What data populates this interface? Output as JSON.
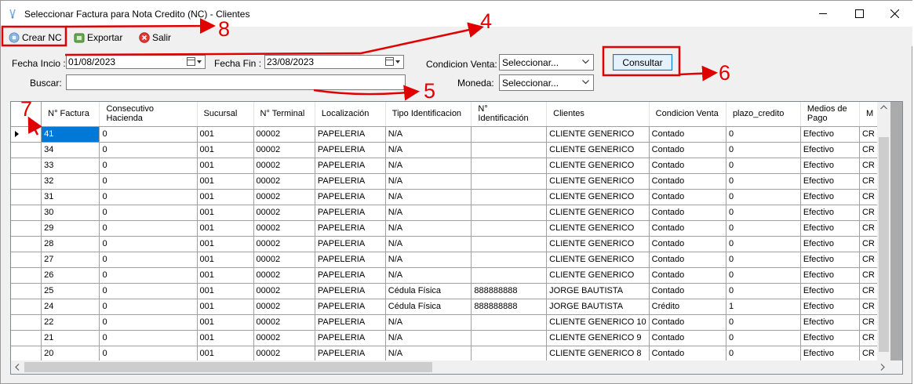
{
  "window": {
    "title": "Seleccionar Factura para Nota Credito (NC) - Clientes"
  },
  "toolbar": {
    "crear_label": "Crear NC",
    "exportar_label": "Exportar",
    "salir_label": "Salir"
  },
  "filters": {
    "fecha_inicio_label": "Fecha Incio :",
    "fecha_inicio_value": "01/08/2023",
    "fecha_fin_label": "Fecha Fin :",
    "fecha_fin_value": "23/08/2023",
    "buscar_label": "Buscar:",
    "buscar_value": "",
    "condicion_label": "Condicion Venta:",
    "condicion_value": "Seleccionar...",
    "moneda_label": "Moneda:",
    "moneda_value": "Seleccionar...",
    "consultar_label": "Consultar"
  },
  "grid": {
    "columns": [
      "N° Factura",
      "Consecutivo Hacienda",
      "Sucursal",
      "N° Terminal",
      "Localización",
      "Tipo Identificacion",
      "N° Identificación",
      "Clientes",
      "Condicion Venta",
      "plazo_credito",
      "Medios de Pago",
      "M"
    ],
    "rows": [
      [
        "41",
        "0",
        "001",
        "00002",
        "PAPELERIA",
        "N/A",
        "",
        "CLIENTE GENERICO",
        "Contado",
        "0",
        "Efectivo",
        "CR"
      ],
      [
        "34",
        "0",
        "001",
        "00002",
        "PAPELERIA",
        "N/A",
        "",
        "CLIENTE GENERICO",
        "Contado",
        "0",
        "Efectivo",
        "CR"
      ],
      [
        "33",
        "0",
        "001",
        "00002",
        "PAPELERIA",
        "N/A",
        "",
        "CLIENTE GENERICO",
        "Contado",
        "0",
        "Efectivo",
        "CR"
      ],
      [
        "32",
        "0",
        "001",
        "00002",
        "PAPELERIA",
        "N/A",
        "",
        "CLIENTE GENERICO",
        "Contado",
        "0",
        "Efectivo",
        "CR"
      ],
      [
        "31",
        "0",
        "001",
        "00002",
        "PAPELERIA",
        "N/A",
        "",
        "CLIENTE GENERICO",
        "Contado",
        "0",
        "Efectivo",
        "CR"
      ],
      [
        "30",
        "0",
        "001",
        "00002",
        "PAPELERIA",
        "N/A",
        "",
        "CLIENTE GENERICO",
        "Contado",
        "0",
        "Efectivo",
        "CR"
      ],
      [
        "29",
        "0",
        "001",
        "00002",
        "PAPELERIA",
        "N/A",
        "",
        "CLIENTE GENERICO",
        "Contado",
        "0",
        "Efectivo",
        "CR"
      ],
      [
        "28",
        "0",
        "001",
        "00002",
        "PAPELERIA",
        "N/A",
        "",
        "CLIENTE GENERICO",
        "Contado",
        "0",
        "Efectivo",
        "CR"
      ],
      [
        "27",
        "0",
        "001",
        "00002",
        "PAPELERIA",
        "N/A",
        "",
        "CLIENTE GENERICO",
        "Contado",
        "0",
        "Efectivo",
        "CR"
      ],
      [
        "26",
        "0",
        "001",
        "00002",
        "PAPELERIA",
        "N/A",
        "",
        "CLIENTE GENERICO",
        "Contado",
        "0",
        "Efectivo",
        "CR"
      ],
      [
        "25",
        "0",
        "001",
        "00002",
        "PAPELERIA",
        "Cédula Física",
        "888888888",
        "JORGE BAUTISTA",
        "Contado",
        "0",
        "Efectivo",
        "CR"
      ],
      [
        "24",
        "0",
        "001",
        "00002",
        "PAPELERIA",
        "Cédula Física",
        "888888888",
        "JORGE BAUTISTA",
        "Crédito",
        "1",
        "Efectivo",
        "CR"
      ],
      [
        "22",
        "0",
        "001",
        "00002",
        "PAPELERIA",
        "N/A",
        "",
        "CLIENTE GENERICO 10",
        "Contado",
        "0",
        "Efectivo",
        "CR"
      ],
      [
        "21",
        "0",
        "001",
        "00002",
        "PAPELERIA",
        "N/A",
        "",
        "CLIENTE GENERICO 9",
        "Contado",
        "0",
        "Efectivo",
        "CR"
      ],
      [
        "20",
        "0",
        "001",
        "00002",
        "PAPELERIA",
        "N/A",
        "",
        "CLIENTE GENERICO 8",
        "Contado",
        "0",
        "Efectivo",
        "CR"
      ]
    ]
  },
  "annotations": {
    "n4": "4",
    "n5": "5",
    "n6": "6",
    "n7": "7",
    "n8": "8",
    "color": "#e00000"
  }
}
